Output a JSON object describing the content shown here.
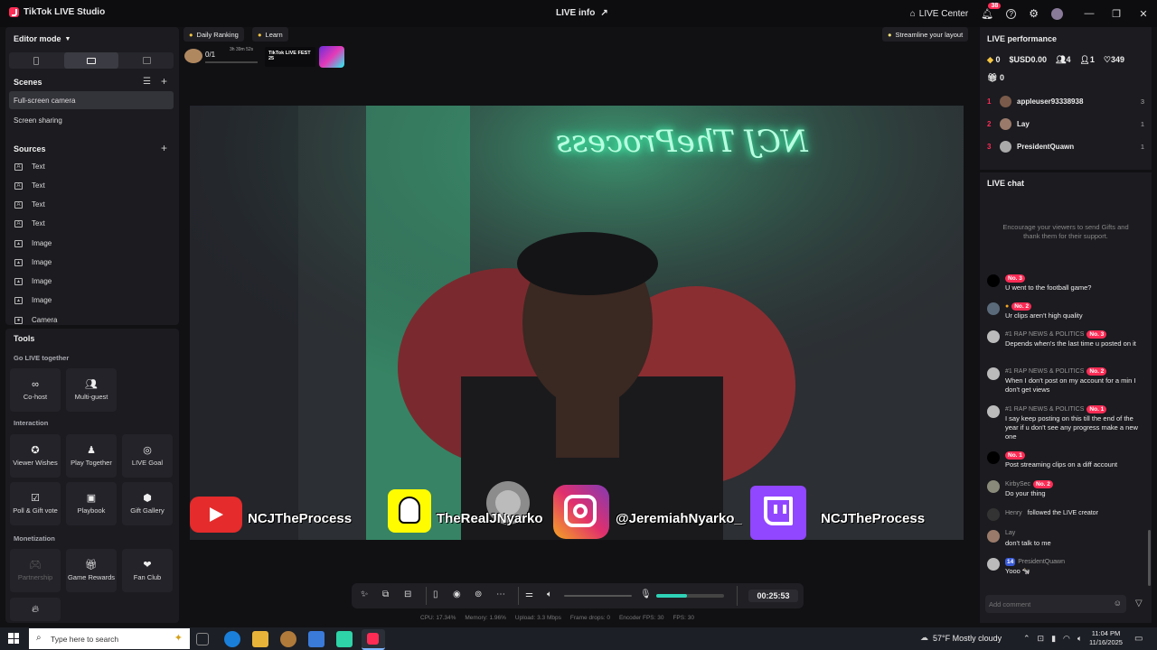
{
  "titlebar": {
    "app_title": "TikTok LIVE Studio",
    "center_title": "LIVE info",
    "live_center": "LIVE Center",
    "notification_count": "38"
  },
  "editor": {
    "mode_label": "Editor mode"
  },
  "scenes": {
    "title": "Scenes",
    "items": [
      {
        "label": "Full-screen camera"
      },
      {
        "label": "Screen sharing"
      }
    ]
  },
  "sources": {
    "title": "Sources",
    "items": [
      {
        "label": "Text",
        "icon": "text-icon"
      },
      {
        "label": "Text",
        "icon": "text-icon"
      },
      {
        "label": "Text",
        "icon": "text-icon"
      },
      {
        "label": "Text",
        "icon": "text-icon"
      },
      {
        "label": "Image",
        "icon": "image-icon"
      },
      {
        "label": "Image",
        "icon": "image-icon"
      },
      {
        "label": "Image",
        "icon": "image-icon"
      },
      {
        "label": "Image",
        "icon": "image-icon"
      },
      {
        "label": "Camera",
        "icon": "camera-icon"
      }
    ]
  },
  "tools": {
    "title": "Tools",
    "go_live_together": "Go LIVE together",
    "cohost": "Co-host",
    "multiguest": "Multi-guest",
    "interaction": "Interaction",
    "viewer_wishes": "Viewer Wishes",
    "play_together": "Play Together",
    "live_goal": "LIVE Goal",
    "poll": "Poll & Gift vote",
    "playbook": "Playbook",
    "gift_gallery": "Gift Gallery",
    "monetization": "Monetization",
    "partnership": "Partnership",
    "game_rewards": "Game Rewards",
    "fan_club": "Fan Club"
  },
  "preview": {
    "daily_ranking": "Daily Ranking",
    "learn": "Learn",
    "streamline": "Streamline your layout",
    "rank_progress": "0/1",
    "timer_small": "3h 39m 52s",
    "fest_label": "TikTok LIVE FEST 25",
    "neon_text": "NCJ TheProcess",
    "socials": [
      {
        "handle": "NCJTheProcess",
        "platform": "youtube"
      },
      {
        "handle": "TheRealJNyarko",
        "platform": "snapchat"
      },
      {
        "handle": "@JeremiahNyarko_",
        "platform": "instagram"
      },
      {
        "handle": "NCJTheProcess",
        "platform": "twitch"
      }
    ]
  },
  "controls": {
    "timer": "00:25:53",
    "mic_level": 0.45
  },
  "stats": {
    "cpu": "CPU: 17.34%",
    "memory": "Memory: 1.96%",
    "upload": "Upload: 3.3 Mbps",
    "frame_drops": "Frame drops: 0",
    "encoder_fps": "Encoder FPS: 30",
    "fps": "FPS: 30"
  },
  "performance": {
    "title": "LIVE performance",
    "diamonds": "0",
    "usd": "USD0.00",
    "viewers": "4",
    "new_followers": "1",
    "likes": "349",
    "gifts": "0",
    "ranking": [
      {
        "rank": "1",
        "name": "appleuser93338938",
        "count": "3"
      },
      {
        "rank": "2",
        "name": "Lay",
        "count": "1"
      },
      {
        "rank": "3",
        "name": "PresidentQuawn",
        "count": "1"
      }
    ]
  },
  "chat": {
    "title": "LIVE chat",
    "hint": "Encourage your viewers to send Gifts and thank them for their support.",
    "placeholder": "Add comment",
    "messages": [
      {
        "user": "",
        "badge": "No. 3",
        "text": "U went to the football game?"
      },
      {
        "user": "",
        "badge": "No. 2",
        "text": "Ur clips aren't high quality"
      },
      {
        "user": "#1 RAP NEWS & POLITICS",
        "badge": "No. 3",
        "text": "Depends when's the last time u posted on it"
      },
      {
        "user": "#1 RAP NEWS & POLITICS",
        "badge": "No. 2",
        "text": "When I don't post on my account for a min I don't get views"
      },
      {
        "user": "#1 RAP NEWS & POLITICS",
        "badge": "No. 1",
        "text": "I say keep posting on this till the end of the year if u don't see any progress make a new one"
      },
      {
        "user": "",
        "badge": "No. 1",
        "text": "Post streaming clips on a diff account"
      },
      {
        "user": "KirbySec",
        "badge": "No. 2",
        "text": "Do your thing"
      },
      {
        "user": "Henry",
        "badge": "",
        "text": "followed the LIVE creator"
      },
      {
        "user": "Lay",
        "badge": "",
        "text": "don't talk to me"
      },
      {
        "user": "PresidentQuawn",
        "badge": "14",
        "text": "Yooo 🐄"
      }
    ]
  },
  "taskbar": {
    "search_placeholder": "Type here to search",
    "weather": "57°F  Mostly cloudy",
    "time": "11:04 PM",
    "date": "11/16/2025"
  }
}
